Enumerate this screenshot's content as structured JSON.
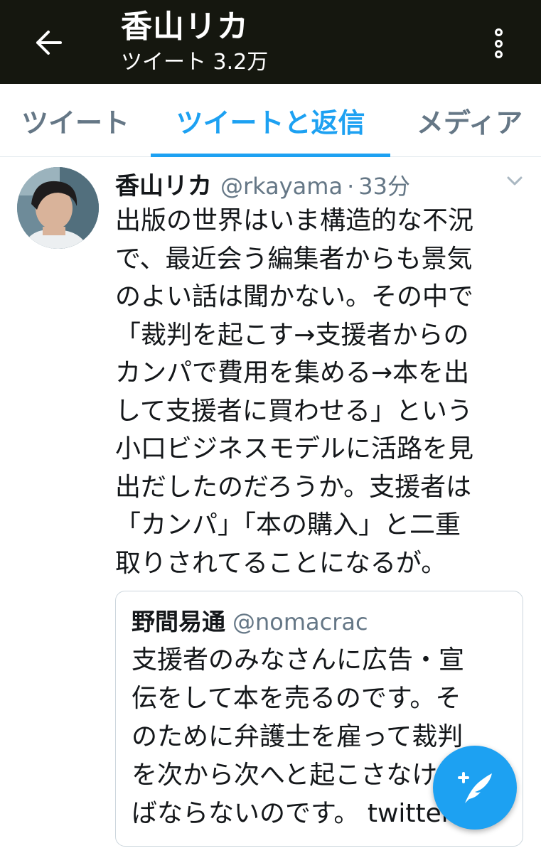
{
  "header": {
    "title": "香山リカ",
    "subtitle": "ツイート 3.2万",
    "back_icon": "back-arrow-icon",
    "menu_icon": "more-vertical-icon"
  },
  "tabs": [
    {
      "label": "ツイート",
      "active": false
    },
    {
      "label": "ツイートと返信",
      "active": true
    },
    {
      "label": "メディア",
      "active": false
    }
  ],
  "tweet": {
    "name": "香山リカ",
    "handle": "@rkayama",
    "separator": "·",
    "time": "33分",
    "lines": [
      "出版の世界はいま構造的な不況",
      "で、最近会う編集者からも景気",
      "のよい話は聞かない。その中で",
      "「裁判を起こす→支援者からの",
      "カンパで費用を集める→本を出",
      "して支援者に買わせる」という",
      "小口ビジネスモデルに活路を見",
      "出だしたのだろうか。支援者は",
      "「カンパ」「本の購入」と二重",
      "取りされてることになるが。"
    ],
    "quote": {
      "name": "野間易通",
      "handle": "@nomacrac",
      "lines": [
        "支援者のみなさんに広告・宣",
        "伝をして本を売るのです。そ",
        "のために弁護士を雇って裁判",
        "を次から次へと起こさなけれ",
        "ばならないのです。 twitter"
      ]
    }
  },
  "colors": {
    "accent": "#1da1f2",
    "header_bg": "#15170f",
    "muted": "#657786"
  },
  "fab": {
    "icon": "compose-tweet-icon"
  }
}
